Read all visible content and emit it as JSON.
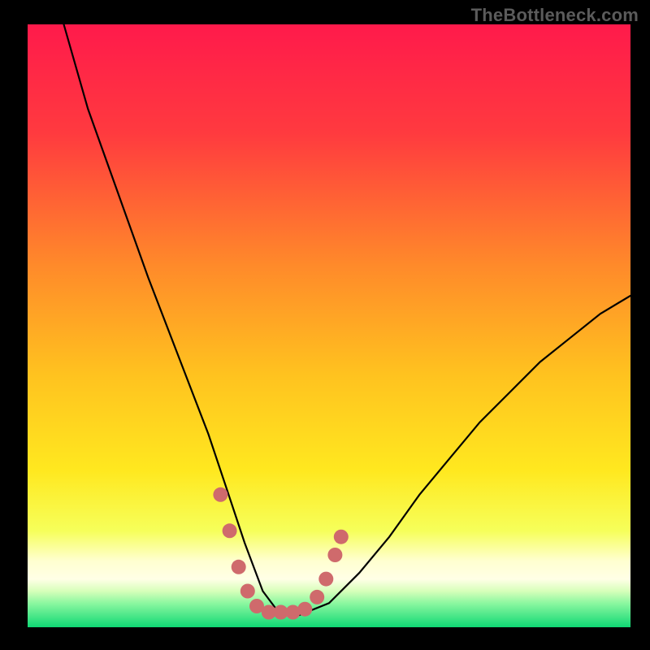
{
  "watermark": "TheBottleneck.com",
  "chart_data": {
    "type": "line",
    "title": "",
    "xlabel": "",
    "ylabel": "",
    "xlim": [
      0,
      100
    ],
    "ylim": [
      0,
      100
    ],
    "grid": false,
    "legend": false,
    "background": {
      "gradient_top": "#ff1a4b",
      "gradient_mid_upper": "#ff6a2a",
      "gradient_mid": "#ffd21f",
      "gradient_lower": "#f7ff66",
      "gradient_band_pale": "#ffffc8",
      "gradient_bottom": "#12e47a"
    },
    "series": [
      {
        "name": "bottleneck-curve",
        "color": "#000000",
        "x": [
          6,
          10,
          15,
          20,
          25,
          30,
          33,
          36,
          39,
          42,
          45,
          50,
          55,
          60,
          65,
          70,
          75,
          80,
          85,
          90,
          95,
          100
        ],
        "y": [
          100,
          86,
          72,
          58,
          45,
          32,
          23,
          14,
          6,
          2,
          2,
          4,
          9,
          15,
          22,
          28,
          34,
          39,
          44,
          48,
          52,
          55
        ]
      }
    ],
    "annotations": [
      {
        "name": "valley-marker",
        "type": "scatter-band",
        "color": "#cf6a6c",
        "points": [
          {
            "x": 32,
            "y": 22
          },
          {
            "x": 33.5,
            "y": 16
          },
          {
            "x": 35,
            "y": 10
          },
          {
            "x": 36.5,
            "y": 6
          },
          {
            "x": 38,
            "y": 3.5
          },
          {
            "x": 40,
            "y": 2.5
          },
          {
            "x": 42,
            "y": 2.5
          },
          {
            "x": 44,
            "y": 2.5
          },
          {
            "x": 46,
            "y": 3
          },
          {
            "x": 48,
            "y": 5
          },
          {
            "x": 49.5,
            "y": 8
          },
          {
            "x": 51,
            "y": 12
          },
          {
            "x": 52,
            "y": 15
          }
        ]
      }
    ]
  }
}
